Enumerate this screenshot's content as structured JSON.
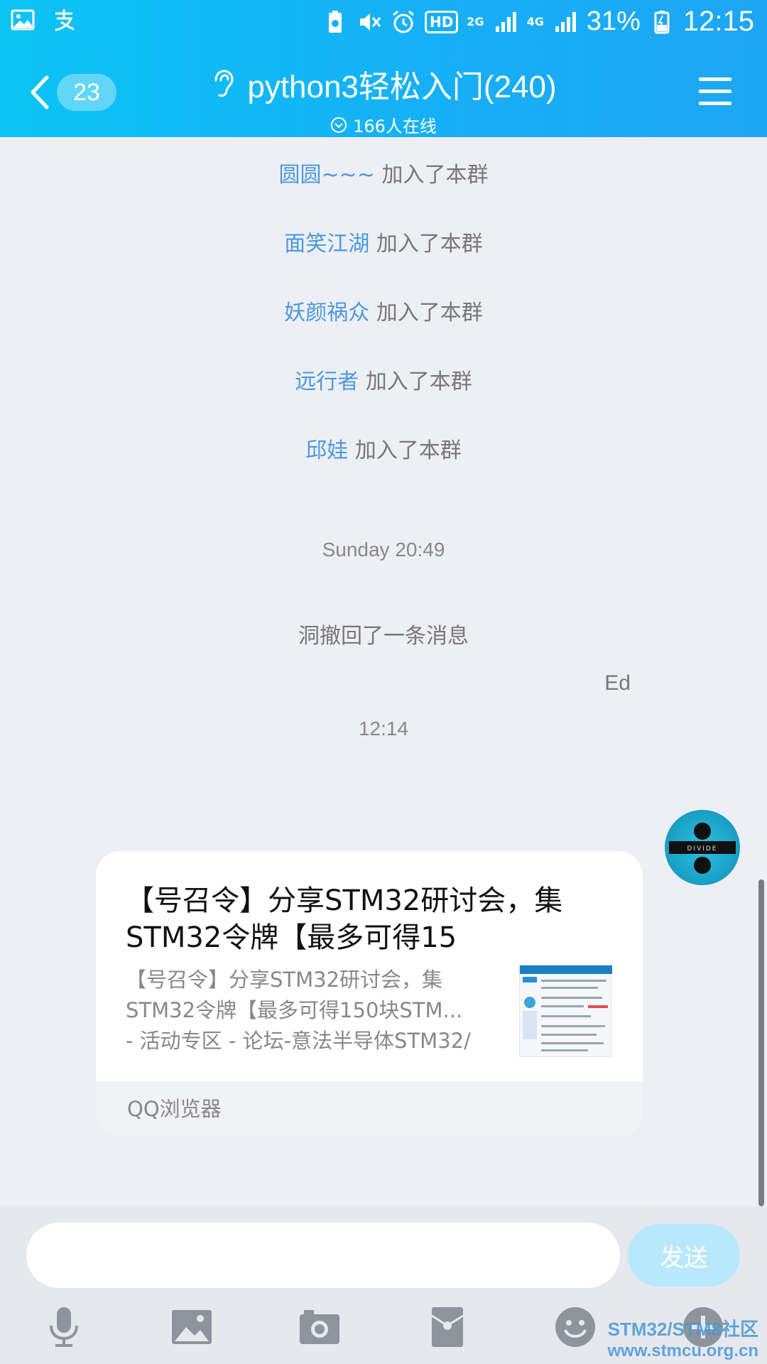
{
  "status_bar": {
    "battery_percent": "31%",
    "time": "12:15",
    "hd": "HD",
    "net_2g": "2G",
    "net_4g": "4G"
  },
  "header": {
    "unread_count": "23",
    "title": "python3轻松入门(240)",
    "online": "166人在线"
  },
  "system_messages": [
    {
      "name": "圆圆~~~",
      "action": "加入了本群"
    },
    {
      "name": "面笑江湖",
      "action": "加入了本群"
    },
    {
      "name": "妖颜祸众",
      "action": "加入了本群"
    },
    {
      "name": "远行者",
      "action": "加入了本群"
    },
    {
      "name": "邱娃",
      "action": "加入了本群"
    }
  ],
  "timestamps": {
    "first": "Sunday 20:49",
    "second": "12:14"
  },
  "recall_notice": "洞撤回了一条消息",
  "message": {
    "sender": "Ed",
    "avatar_text": "DIVIDE",
    "card_title": "【号召令】分享STM32研讨会，集STM32令牌【最多可得15",
    "card_desc_line1": "【号召令】分享STM32研讨会，集",
    "card_desc_line2": "STM32令牌【最多可得150块STM...",
    "card_desc_line3": "- 活动专区 - 论坛-意法半导体STM32/",
    "card_source": "QQ浏览器"
  },
  "input": {
    "placeholder": "",
    "send_label": "发送"
  },
  "watermark": {
    "line1": "STM32/STM8社区",
    "line2": "www.stmcu.org.cn"
  },
  "colors": {
    "header_start": "#0bc4f5",
    "header_end": "#1ea6f4",
    "name_link": "#4a98e0",
    "send_disabled": "#b8e8fb"
  }
}
